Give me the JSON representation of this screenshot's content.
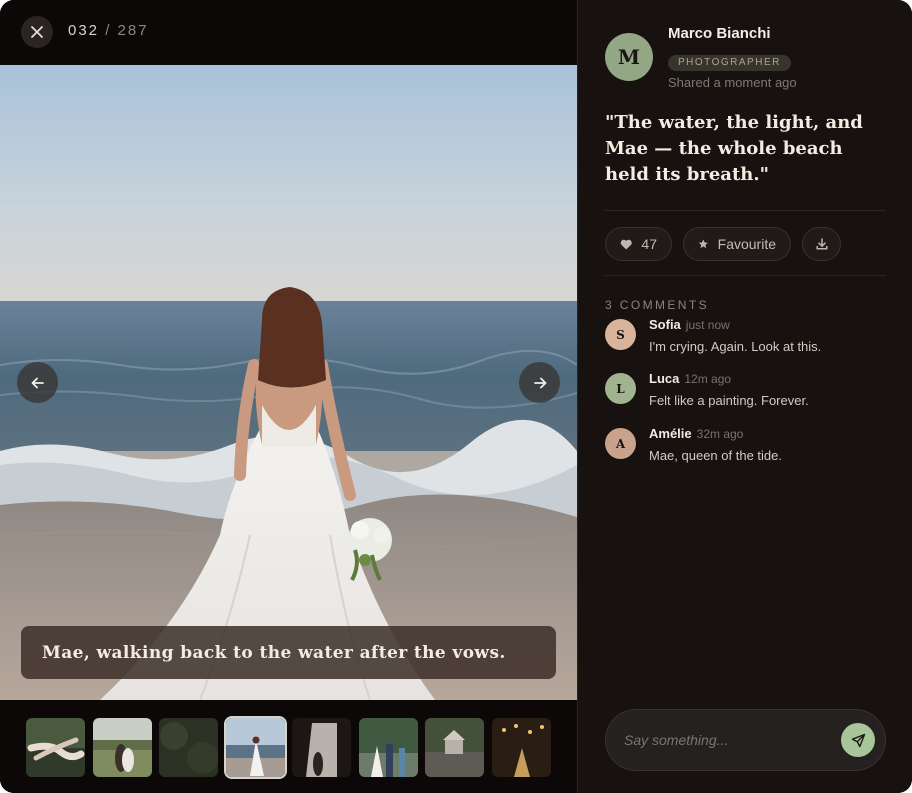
{
  "viewer": {
    "counter": {
      "current": "032",
      "separator": "/",
      "total": "287"
    },
    "caption": "Mae, walking back to the water after the vows.",
    "icons": {
      "close": "close-icon",
      "prev": "arrow-left-icon",
      "next": "arrow-right-icon"
    },
    "thumbnails": [
      {
        "name": "holding-hands"
      },
      {
        "name": "couple-field"
      },
      {
        "name": "dark-foliage"
      },
      {
        "name": "bride-beach",
        "active": true
      },
      {
        "name": "doorway-silhouette"
      },
      {
        "name": "ceremony-group"
      },
      {
        "name": "gazebo-garden"
      },
      {
        "name": "evening-lights"
      }
    ]
  },
  "author": {
    "initial": "M",
    "name": "Marco Bianchi",
    "role": "PHOTOGRAPHER",
    "shared": "Shared a moment ago"
  },
  "post": {
    "quote": "\"The water, the light, and Mae — the whole beach held its breath.\""
  },
  "actions": {
    "likes": "47",
    "favourite_label": "Favourite",
    "icons": {
      "like": "heart-icon",
      "favourite": "star-icon",
      "download": "download-icon"
    }
  },
  "comments": {
    "heading": "3 COMMENTS",
    "items": [
      {
        "initial": "S",
        "name": "Sofia",
        "time": "just now",
        "text": "I'm crying. Again. Look at this.",
        "avatar_color": "#d8b49a"
      },
      {
        "initial": "L",
        "name": "Luca",
        "time": "12m ago",
        "text": "Felt like a painting. Forever.",
        "avatar_color": "#9fb48f"
      },
      {
        "initial": "A",
        "name": "Amélie",
        "time": "32m ago",
        "text": "Mae, queen of the tide.",
        "avatar_color": "#c9a28b"
      }
    ]
  },
  "composer": {
    "placeholder": "Say something...",
    "send_icon": "send-icon"
  },
  "colors": {
    "panel_bg": "#171210",
    "viewer_bg": "#0c0807",
    "accent_green": "#a9c59a",
    "avatar_main": "#93a784"
  }
}
